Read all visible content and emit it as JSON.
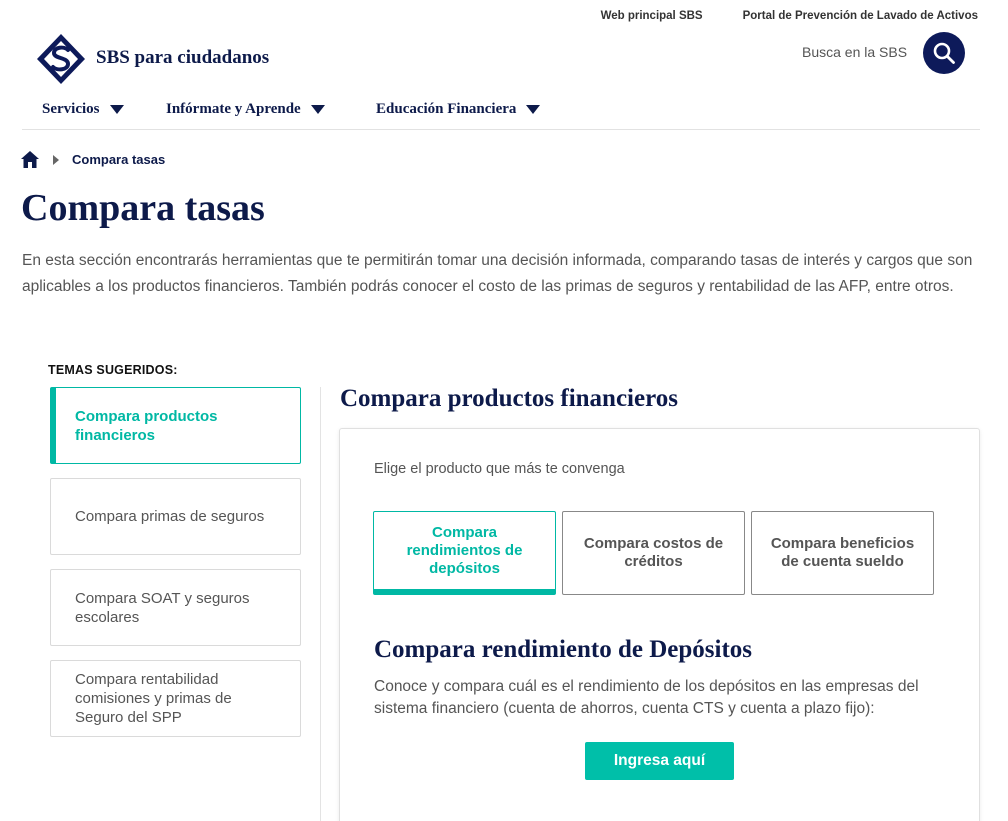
{
  "utility_links": [
    "Web principal SBS",
    "Portal de Prevención de Lavado de Activos"
  ],
  "brand": {
    "name": "SBS para ciudadanos"
  },
  "search": {
    "label": "Busca en la SBS",
    "icon": "search-icon"
  },
  "nav": {
    "items": [
      {
        "label": "Servicios"
      },
      {
        "label": "Infórmate y Aprende"
      },
      {
        "label": "Educación Financiera"
      }
    ]
  },
  "breadcrumb": {
    "home_icon": "home-icon",
    "current": "Compara tasas"
  },
  "page": {
    "title": "Compara tasas",
    "intro": "En esta sección encontrarás herramientas que te permitirán tomar una decisión informada, comparando tasas de interés y cargos que son aplicables a los productos financieros. También podrás conocer el costo de las primas de seguros y rentabilidad de las AFP, entre otros."
  },
  "sidebar": {
    "label": "TEMAS SUGERIDOS:",
    "items": [
      {
        "label": "Compara productos financieros",
        "active": true
      },
      {
        "label": "Compara primas de seguros",
        "active": false
      },
      {
        "label": "Compara SOAT y seguros escolares",
        "active": false
      },
      {
        "label": "Compara rentabilidad comisiones y primas de Seguro del SPP",
        "active": false
      }
    ]
  },
  "main": {
    "title": "Compara productos financieros",
    "choose_text": "Elige el producto que más te convenga",
    "options": [
      {
        "label": "Compara rendimientos de depósitos",
        "active": true
      },
      {
        "label": "Compara costos de créditos",
        "active": false
      },
      {
        "label": "Compara beneficios de cuenta sueldo",
        "active": false
      }
    ],
    "sub_title": "Compara rendimiento de Depósitos",
    "sub_desc": "Conoce y compara cuál es el rendimiento de los depósitos en las empresas del sistema financiero (cuenta de ahorros, cuenta CTS y cuenta a plazo fijo):",
    "cta_label": "Ingresa aquí"
  },
  "colors": {
    "navy": "#0d1a4a",
    "teal": "#00bfa9",
    "text": "#555555"
  }
}
